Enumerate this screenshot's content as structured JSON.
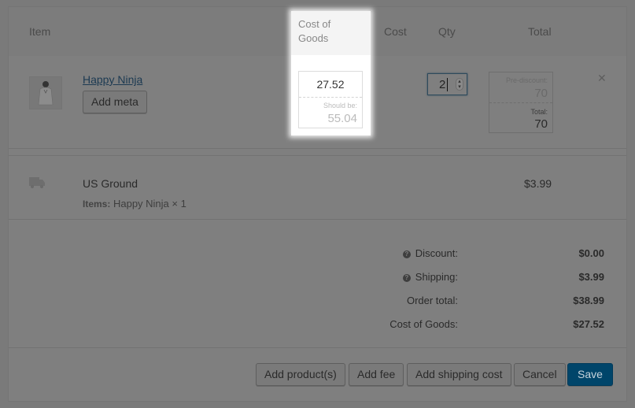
{
  "table": {
    "headers": {
      "item": "Item",
      "cost_of_goods": "Cost of Goods",
      "cost": "Cost",
      "qty": "Qty",
      "total": "Total"
    }
  },
  "line_item": {
    "product_name": "Happy Ninja",
    "add_meta_label": "Add meta",
    "cost_of_goods_value": "27.52",
    "should_be_label": "Should be:",
    "should_be_value": "55.04",
    "qty_value": "2",
    "pre_discount_label": "Pre-discount:",
    "pre_discount_value": "70",
    "total_label": "Total:",
    "total_value": "70",
    "remove_icon": "close-icon"
  },
  "shipping_line": {
    "icon": "truck-icon",
    "method": "US Ground",
    "items_label": "Items:",
    "items_value": "Happy Ninja × 1",
    "cost": "$3.99"
  },
  "totals": [
    {
      "label": "Discount:",
      "value": "$0.00",
      "help": true
    },
    {
      "label": "Shipping:",
      "value": "$3.99",
      "help": true
    },
    {
      "label": "Order total:",
      "value": "$38.99",
      "help": false
    },
    {
      "label": "Cost of Goods:",
      "value": "$27.52",
      "help": false
    }
  ],
  "actions": {
    "add_products": "Add product(s)",
    "add_fee": "Add fee",
    "add_shipping": "Add shipping cost",
    "cancel": "Cancel",
    "save": "Save"
  },
  "colors": {
    "overlay_bg": "#7a7a7a",
    "spotlight": "#ffffff",
    "primary_button": "#00456a",
    "link": "#1c3a52"
  }
}
